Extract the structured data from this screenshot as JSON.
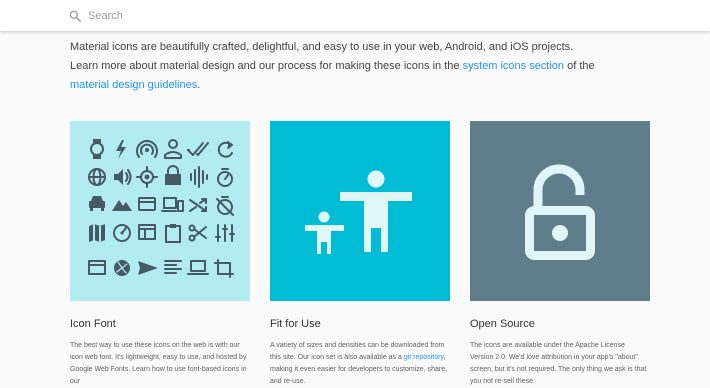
{
  "search": {
    "placeholder": "Search"
  },
  "intro": {
    "line1": "Material icons are beautifully crafted, delightful, and easy to use in your web, Android, and iOS projects.",
    "line2_pre": "Learn more about material design and our process for making these icons in the ",
    "system_icons_link": "system icons section",
    "line2_post": " of the",
    "guidelines_link": "material design guidelines",
    "line3_post": "."
  },
  "cards": [
    {
      "title": "Icon Font",
      "text": "The best way to use these icons on the web is with our icon web font. It's lightweight, easy to use, and hosted by Google Web Fonts. Learn how to use font-based icons in our",
      "bg": "#b3ebf2",
      "icon_color": "#455a64"
    },
    {
      "title": "Fit for Use",
      "text_pre": "A variety of sizes and densities can be downloaded from this site. Our icon set is also available as a ",
      "link": "git repository",
      "text_post": ", making it even easier for developers to customize, share, and re-use.",
      "bg": "#00bcd4",
      "icon_color": "#e0f7fa"
    },
    {
      "title": "Open Source",
      "text": "The icons are available under the Apache License Version 2.0. We'd love attribution in your app's \"about\" screen, but it's not required. The only thing we ask is that you not re-sell these",
      "bg": "#607d8b",
      "icon_color": "#e0f7fa"
    }
  ],
  "icon_grid": [
    [
      "watch-icon",
      "flash-icon",
      "wifi-tethering-icon",
      "person-outline-icon",
      "done-all-icon",
      "refresh-icon"
    ],
    [
      "language-icon",
      "volume-up-icon",
      "gps-fixed-icon",
      "lock-icon",
      "graphic-eq-icon",
      "timer-icon"
    ],
    [
      "directions-car-icon",
      "landscape-icon",
      "credit-card-icon",
      "devices-icon",
      "shuffle-icon",
      "timer-off-icon"
    ],
    [
      "map-icon",
      "speed-icon",
      "web-icon",
      "assignment-icon",
      "content-cut-icon",
      "tune-icon"
    ],
    [
      "tab-icon",
      "camera-icon",
      "send-icon",
      "format-align-left-icon",
      "laptop-icon",
      "crop-icon"
    ]
  ]
}
